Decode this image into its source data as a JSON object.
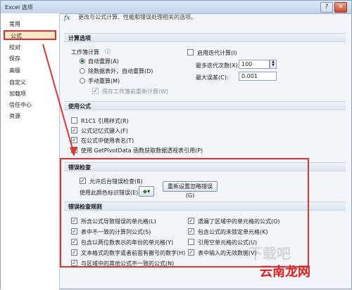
{
  "window": {
    "title": "Excel 选项",
    "help": "?",
    "close": "✕"
  },
  "sidebar": {
    "items": [
      "常用",
      "公式",
      "校对",
      "保存",
      "高级",
      "自定义",
      "加载项",
      "信任中心",
      "资源"
    ]
  },
  "header": {
    "description": "更改与公式计算、性能和错误处理相关的选项。"
  },
  "calc": {
    "section": "计算选项",
    "workbook_label": "工作簿计算",
    "auto": "自动重算(A)",
    "auto_except": "除数据表外，自动重算(D)",
    "manual": "手动重算(M)",
    "recalc_before_save": "保存工作簿前重新计算(W)",
    "iterative": "启用迭代计算(I)",
    "max_iter_label": "最多迭代次数(X):",
    "max_iter_value": "100",
    "max_change_label": "最大误差(C):",
    "max_change_value": "0.001"
  },
  "formulas": {
    "section": "使用公式",
    "r1c1": "R1C1 引用样式(R)",
    "autocomplete": "公式记忆式键入(F)",
    "table_names": "在公式中使用表名(T)",
    "getpivot": "使用 GetPivotData 函数获取数据透视表引用(P)"
  },
  "error_check": {
    "section": "错误检查",
    "enable_bg": "允许后台错误检查(B)",
    "indicator_label": "使用此颜色标识错误(E):",
    "reset_button": "重新设置忽略错误(G)"
  },
  "rules": {
    "section": "错误检查规则",
    "left": [
      "所含公式导致错误的单元格(L)",
      "表中不一致的计算列公式(S)",
      "包含以两位数表示的年份的单元格(Y)",
      "文本格式的数字或者前面有撇号的数字(H)",
      "与区域中的其他公式不一致的公式(N)"
    ],
    "right": [
      "遗漏了区域中的单元格的公式(O)",
      "包含公式的未锁定单元格(K)",
      "引用空单元格的公式(U)",
      "表中输入的无效数据(V)"
    ]
  },
  "watermark": {
    "main": "云南龙网",
    "faint": "下载吧"
  },
  "colors": {
    "highlight": "#e23434",
    "selected_bg": "#fce8c6",
    "section_bg": "#dde5ef"
  }
}
